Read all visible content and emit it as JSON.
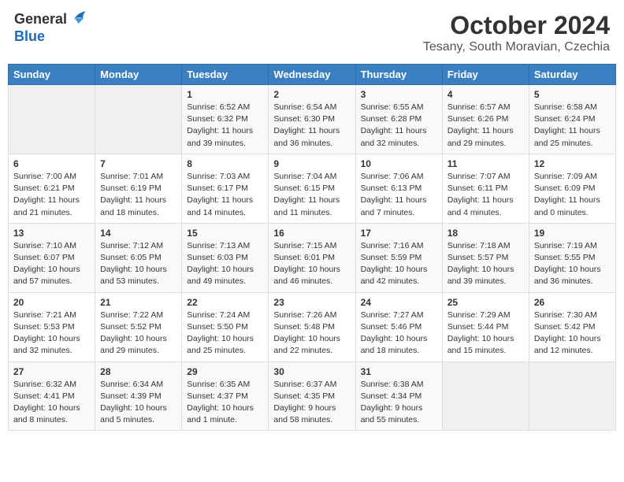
{
  "header": {
    "logo_line1": "General",
    "logo_line2": "Blue",
    "month": "October 2024",
    "location": "Tesany, South Moravian, Czechia"
  },
  "columns": [
    "Sunday",
    "Monday",
    "Tuesday",
    "Wednesday",
    "Thursday",
    "Friday",
    "Saturday"
  ],
  "weeks": [
    [
      {
        "day": "",
        "info": ""
      },
      {
        "day": "",
        "info": ""
      },
      {
        "day": "1",
        "info": "Sunrise: 6:52 AM\nSunset: 6:32 PM\nDaylight: 11 hours and 39 minutes."
      },
      {
        "day": "2",
        "info": "Sunrise: 6:54 AM\nSunset: 6:30 PM\nDaylight: 11 hours and 36 minutes."
      },
      {
        "day": "3",
        "info": "Sunrise: 6:55 AM\nSunset: 6:28 PM\nDaylight: 11 hours and 32 minutes."
      },
      {
        "day": "4",
        "info": "Sunrise: 6:57 AM\nSunset: 6:26 PM\nDaylight: 11 hours and 29 minutes."
      },
      {
        "day": "5",
        "info": "Sunrise: 6:58 AM\nSunset: 6:24 PM\nDaylight: 11 hours and 25 minutes."
      }
    ],
    [
      {
        "day": "6",
        "info": "Sunrise: 7:00 AM\nSunset: 6:21 PM\nDaylight: 11 hours and 21 minutes."
      },
      {
        "day": "7",
        "info": "Sunrise: 7:01 AM\nSunset: 6:19 PM\nDaylight: 11 hours and 18 minutes."
      },
      {
        "day": "8",
        "info": "Sunrise: 7:03 AM\nSunset: 6:17 PM\nDaylight: 11 hours and 14 minutes."
      },
      {
        "day": "9",
        "info": "Sunrise: 7:04 AM\nSunset: 6:15 PM\nDaylight: 11 hours and 11 minutes."
      },
      {
        "day": "10",
        "info": "Sunrise: 7:06 AM\nSunset: 6:13 PM\nDaylight: 11 hours and 7 minutes."
      },
      {
        "day": "11",
        "info": "Sunrise: 7:07 AM\nSunset: 6:11 PM\nDaylight: 11 hours and 4 minutes."
      },
      {
        "day": "12",
        "info": "Sunrise: 7:09 AM\nSunset: 6:09 PM\nDaylight: 11 hours and 0 minutes."
      }
    ],
    [
      {
        "day": "13",
        "info": "Sunrise: 7:10 AM\nSunset: 6:07 PM\nDaylight: 10 hours and 57 minutes."
      },
      {
        "day": "14",
        "info": "Sunrise: 7:12 AM\nSunset: 6:05 PM\nDaylight: 10 hours and 53 minutes."
      },
      {
        "day": "15",
        "info": "Sunrise: 7:13 AM\nSunset: 6:03 PM\nDaylight: 10 hours and 49 minutes."
      },
      {
        "day": "16",
        "info": "Sunrise: 7:15 AM\nSunset: 6:01 PM\nDaylight: 10 hours and 46 minutes."
      },
      {
        "day": "17",
        "info": "Sunrise: 7:16 AM\nSunset: 5:59 PM\nDaylight: 10 hours and 42 minutes."
      },
      {
        "day": "18",
        "info": "Sunrise: 7:18 AM\nSunset: 5:57 PM\nDaylight: 10 hours and 39 minutes."
      },
      {
        "day": "19",
        "info": "Sunrise: 7:19 AM\nSunset: 5:55 PM\nDaylight: 10 hours and 36 minutes."
      }
    ],
    [
      {
        "day": "20",
        "info": "Sunrise: 7:21 AM\nSunset: 5:53 PM\nDaylight: 10 hours and 32 minutes."
      },
      {
        "day": "21",
        "info": "Sunrise: 7:22 AM\nSunset: 5:52 PM\nDaylight: 10 hours and 29 minutes."
      },
      {
        "day": "22",
        "info": "Sunrise: 7:24 AM\nSunset: 5:50 PM\nDaylight: 10 hours and 25 minutes."
      },
      {
        "day": "23",
        "info": "Sunrise: 7:26 AM\nSunset: 5:48 PM\nDaylight: 10 hours and 22 minutes."
      },
      {
        "day": "24",
        "info": "Sunrise: 7:27 AM\nSunset: 5:46 PM\nDaylight: 10 hours and 18 minutes."
      },
      {
        "day": "25",
        "info": "Sunrise: 7:29 AM\nSunset: 5:44 PM\nDaylight: 10 hours and 15 minutes."
      },
      {
        "day": "26",
        "info": "Sunrise: 7:30 AM\nSunset: 5:42 PM\nDaylight: 10 hours and 12 minutes."
      }
    ],
    [
      {
        "day": "27",
        "info": "Sunrise: 6:32 AM\nSunset: 4:41 PM\nDaylight: 10 hours and 8 minutes."
      },
      {
        "day": "28",
        "info": "Sunrise: 6:34 AM\nSunset: 4:39 PM\nDaylight: 10 hours and 5 minutes."
      },
      {
        "day": "29",
        "info": "Sunrise: 6:35 AM\nSunset: 4:37 PM\nDaylight: 10 hours and 1 minute."
      },
      {
        "day": "30",
        "info": "Sunrise: 6:37 AM\nSunset: 4:35 PM\nDaylight: 9 hours and 58 minutes."
      },
      {
        "day": "31",
        "info": "Sunrise: 6:38 AM\nSunset: 4:34 PM\nDaylight: 9 hours and 55 minutes."
      },
      {
        "day": "",
        "info": ""
      },
      {
        "day": "",
        "info": ""
      }
    ]
  ]
}
